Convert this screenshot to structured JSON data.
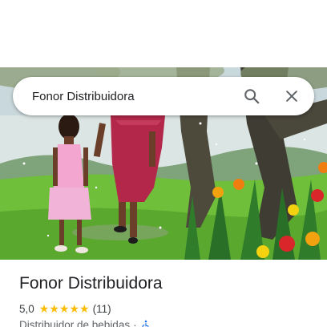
{
  "search": {
    "query": "Fonor Distribuidora",
    "search_icon": "search-icon",
    "close_icon": "close-icon"
  },
  "hero": {
    "description_icon": "photo"
  },
  "place": {
    "name": "Fonor Distribuidora",
    "rating": "5,0",
    "stars": [
      "★",
      "★",
      "★",
      "★",
      "★"
    ],
    "review_count": "(11)",
    "category": "Distribuidor de bebidas",
    "separator": "·",
    "accessibility_icon": "wheelchair-icon"
  },
  "colors": {
    "star": "#fbbc04",
    "accessibility": "#1a73e8"
  }
}
